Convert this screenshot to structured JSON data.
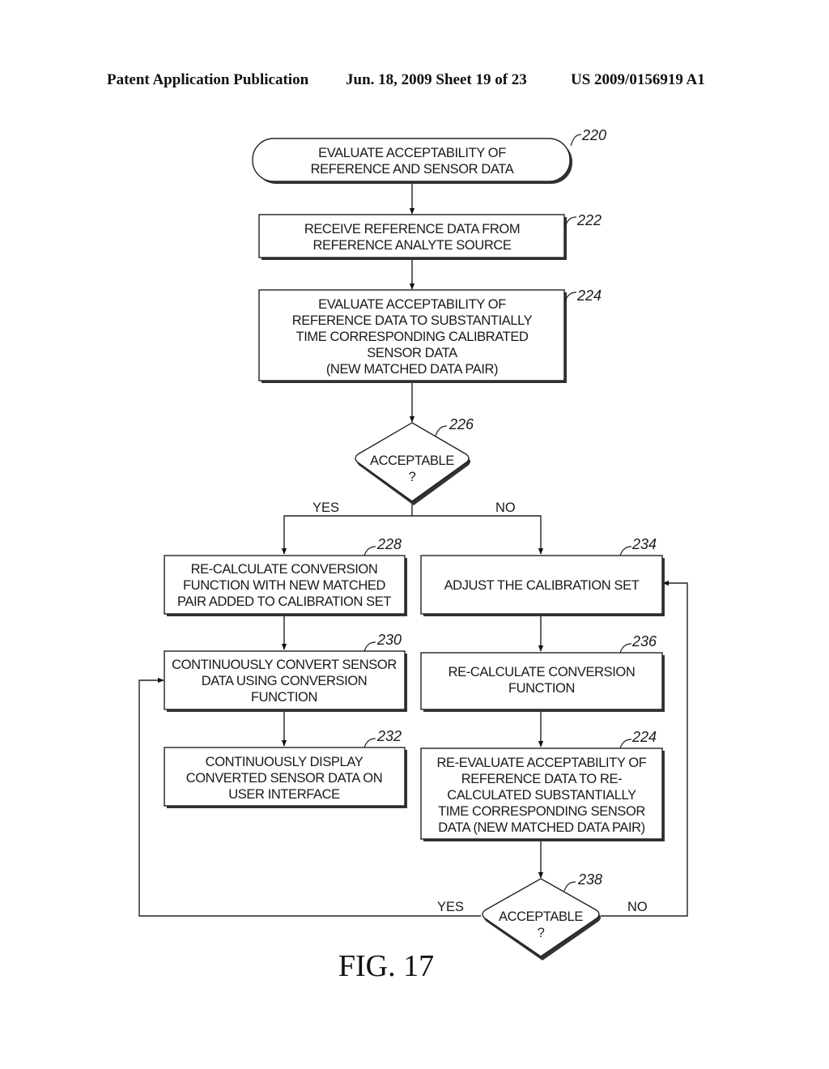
{
  "header": {
    "publication": "Patent Application Publication",
    "date_sheet": "Jun. 18, 2009  Sheet 19 of 23",
    "number": "US 2009/0156919 A1"
  },
  "figure_label": "FIG. 17",
  "nodes": {
    "n220": {
      "ref": "220",
      "type": "terminal",
      "lines": [
        "EVALUATE ACCEPTABILITY OF",
        "REFERENCE AND SENSOR DATA"
      ]
    },
    "n222": {
      "ref": "222",
      "type": "process",
      "lines": [
        "RECEIVE REFERENCE DATA FROM",
        "REFERENCE ANALYTE SOURCE"
      ]
    },
    "n224": {
      "ref": "224",
      "type": "process",
      "lines": [
        "EVALUATE ACCEPTABILITY OF",
        "REFERENCE DATA TO SUBSTANTIALLY",
        "TIME CORRESPONDING CALIBRATED",
        "SENSOR DATA",
        "(NEW MATCHED DATA PAIR)"
      ]
    },
    "n226": {
      "ref": "226",
      "type": "decision",
      "lines": [
        "ACCEPTABLE",
        "?"
      ]
    },
    "n228": {
      "ref": "228",
      "type": "process",
      "lines": [
        "RE-CALCULATE CONVERSION",
        "FUNCTION WITH NEW MATCHED",
        "PAIR ADDED TO CALIBRATION SET"
      ]
    },
    "n230": {
      "ref": "230",
      "type": "process",
      "lines": [
        "CONTINUOUSLY CONVERT SENSOR",
        "DATA USING CONVERSION",
        "FUNCTION"
      ]
    },
    "n232": {
      "ref": "232",
      "type": "process",
      "lines": [
        "CONTINUOUSLY DISPLAY",
        "CONVERTED SENSOR DATA ON",
        "USER INTERFACE"
      ]
    },
    "n234": {
      "ref": "234",
      "type": "process",
      "lines": [
        "ADJUST THE CALIBRATION SET"
      ]
    },
    "n236": {
      "ref": "236",
      "type": "process",
      "lines": [
        "RE-CALCULATE CONVERSION",
        "FUNCTION"
      ]
    },
    "n224b": {
      "ref": "224",
      "type": "process",
      "lines": [
        "RE-EVALUATE ACCEPTABILITY OF",
        "REFERENCE DATA TO RE-",
        "CALCULATED SUBSTANTIALLY",
        "TIME CORRESPONDING SENSOR",
        "DATA (NEW MATCHED DATA PAIR)"
      ]
    },
    "n238": {
      "ref": "238",
      "type": "decision",
      "lines": [
        "ACCEPTABLE",
        "?"
      ]
    }
  },
  "branches": {
    "d226_yes": "YES",
    "d226_no": "NO",
    "d238_yes": "YES",
    "d238_no": "NO"
  },
  "edges": [
    {
      "from": "220",
      "to": "222"
    },
    {
      "from": "222",
      "to": "224"
    },
    {
      "from": "224",
      "to": "226"
    },
    {
      "from": "226",
      "to": "228",
      "label": "YES"
    },
    {
      "from": "226",
      "to": "234",
      "label": "NO"
    },
    {
      "from": "228",
      "to": "230"
    },
    {
      "from": "230",
      "to": "232"
    },
    {
      "from": "234",
      "to": "236"
    },
    {
      "from": "236",
      "to": "224 (re-evaluate)"
    },
    {
      "from": "224 (re-evaluate)",
      "to": "238"
    },
    {
      "from": "238",
      "to": "230",
      "label": "YES"
    },
    {
      "from": "238",
      "to": "234",
      "label": "NO"
    }
  ]
}
